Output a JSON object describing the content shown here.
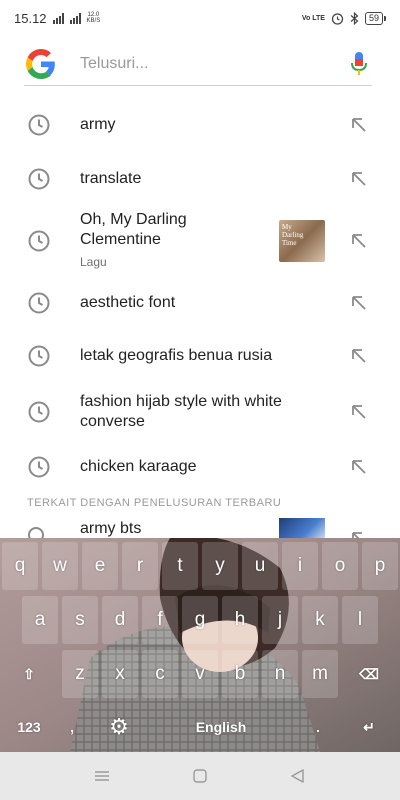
{
  "status": {
    "time": "15.12",
    "net_speed": "12.0",
    "net_unit": "KB/S",
    "volte": "Vo LTE",
    "battery": "59"
  },
  "search": {
    "placeholder": "Telusuri..."
  },
  "suggestions": [
    {
      "label": "army"
    },
    {
      "label": "translate"
    },
    {
      "label": "Oh, My Darling Clementine",
      "sub": "Lagu",
      "thumb_text": "My Darling Time"
    },
    {
      "label": "aesthetic font"
    },
    {
      "label": "letak geografis benua rusia"
    },
    {
      "label": "fashion hijab style with white converse"
    },
    {
      "label": "chicken karaage"
    }
  ],
  "related": {
    "heading": "TERKAIT DENGAN PENELUSURAN TERBARU",
    "items": [
      {
        "label": "army bts"
      }
    ]
  },
  "keyboard": {
    "row1": [
      "q",
      "w",
      "e",
      "r",
      "t",
      "y",
      "u",
      "i",
      "o",
      "p"
    ],
    "row2": [
      "a",
      "s",
      "d",
      "f",
      "g",
      "h",
      "j",
      "k",
      "l"
    ],
    "row3": [
      "z",
      "x",
      "c",
      "v",
      "b",
      "n",
      "m"
    ],
    "shift": "⇧",
    "backspace": "⌫",
    "numbers": "123",
    "comma": ",",
    "space_label": "English",
    "period": ".",
    "enter": "↵"
  },
  "colors": {
    "google_blue": "#4285F4",
    "google_red": "#EA4335",
    "google_yellow": "#FBBC05",
    "google_green": "#34A853"
  }
}
